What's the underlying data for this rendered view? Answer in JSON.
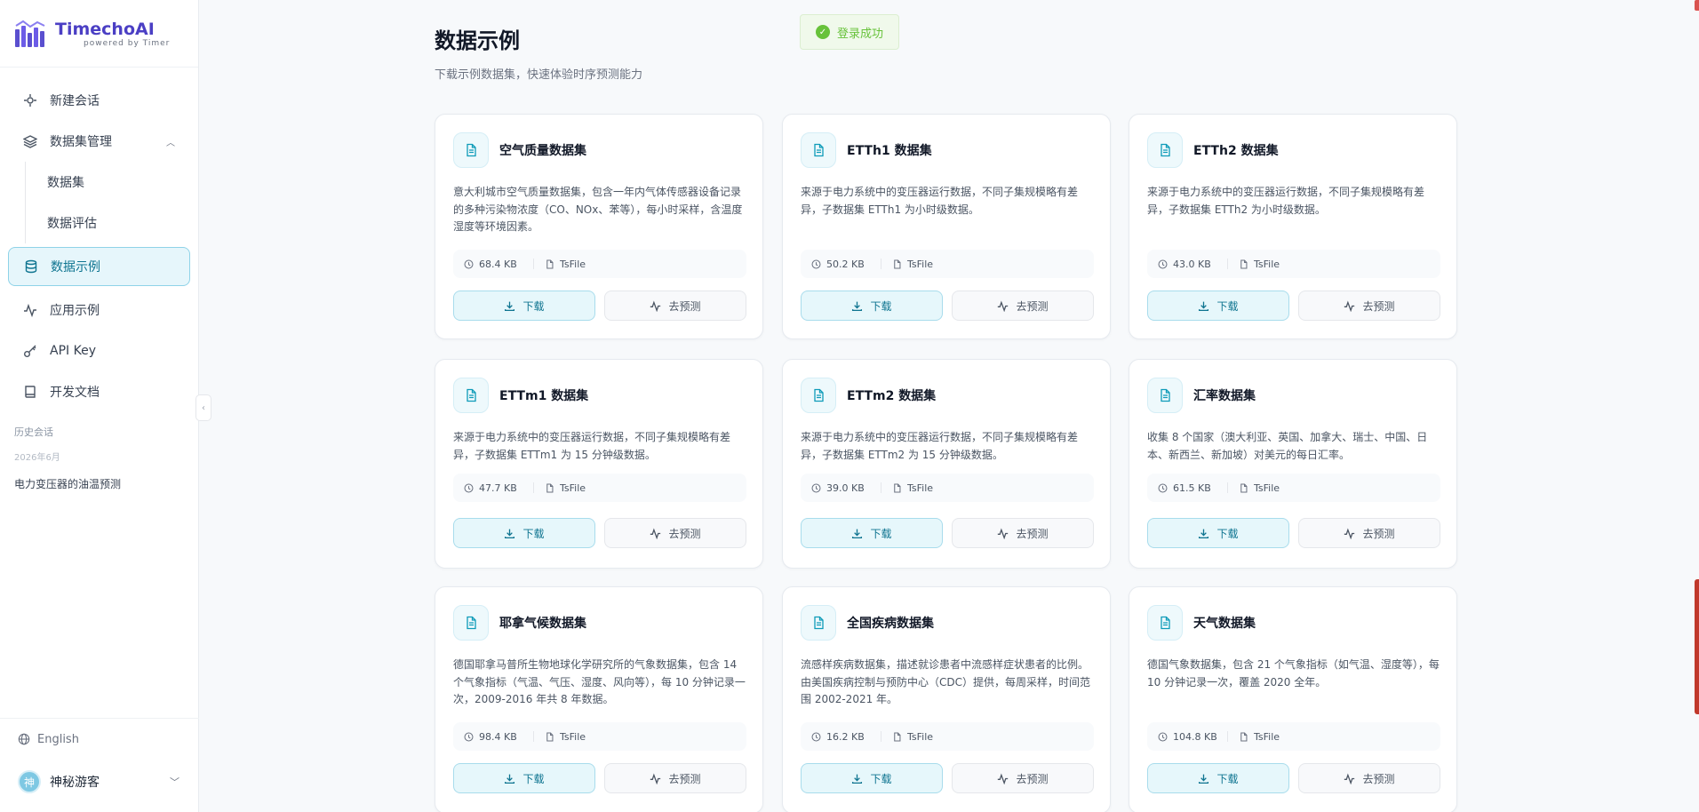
{
  "brand": {
    "name": "TimechoAI",
    "tagline": "powered by Timer",
    "color": "#4b3fc4"
  },
  "sidebar": {
    "items": [
      {
        "label": "新建会话",
        "icon": "sparkle-icon"
      },
      {
        "label": "数据集管理",
        "icon": "layers-icon",
        "expanded": true
      },
      {
        "label": "数据集",
        "sub": true
      },
      {
        "label": "数据评估",
        "sub": true
      },
      {
        "label": "数据示例",
        "icon": "database-icon",
        "active": true
      },
      {
        "label": "应用示例",
        "icon": "activity-icon"
      },
      {
        "label": "API Key",
        "icon": "key-icon"
      },
      {
        "label": "开发文档",
        "icon": "book-icon"
      }
    ],
    "history_label": "历史会话",
    "history_date": "2026年6月",
    "history_items": [
      "电力变压器的油温预测"
    ],
    "language": "English",
    "user_name": "神秘游客",
    "avatar_char": "神"
  },
  "toast": {
    "text": "登录成功",
    "color": "#67c23a"
  },
  "page": {
    "title": "数据示例",
    "subtitle": "下载示例数据集，快速体验时序预测能力"
  },
  "accent": "#0e7490",
  "cards": [
    {
      "title": "空气质量数据集",
      "desc": "意大利城市空气质量数据集，包含一年内气体传感器设备记录的多种污染物浓度（CO、NOx、苯等），每小时采样，含温度湿度等环境因素。",
      "size": "68.4 KB",
      "format": "TsFile",
      "download": "下载",
      "predict": "去预测"
    },
    {
      "title": "ETTh1 数据集",
      "desc": "来源于电力系统中的变压器运行数据，不同子集规模略有差异，子数据集 ETTh1 为小时级数据。",
      "size": "50.2 KB",
      "format": "TsFile",
      "download": "下载",
      "predict": "去预测"
    },
    {
      "title": "ETTh2 数据集",
      "desc": "来源于电力系统中的变压器运行数据，不同子集规模略有差异，子数据集 ETTh2 为小时级数据。",
      "size": "43.0 KB",
      "format": "TsFile",
      "download": "下载",
      "predict": "去预测"
    },
    {
      "title": "ETTm1 数据集",
      "desc": "来源于电力系统中的变压器运行数据，不同子集规模略有差异，子数据集 ETTm1 为 15 分钟级数据。",
      "size": "47.7 KB",
      "format": "TsFile",
      "download": "下载",
      "predict": "去预测"
    },
    {
      "title": "ETTm2 数据集",
      "desc": "来源于电力系统中的变压器运行数据，不同子集规模略有差异，子数据集 ETTm2 为 15 分钟级数据。",
      "size": "39.0 KB",
      "format": "TsFile",
      "download": "下载",
      "predict": "去预测"
    },
    {
      "title": "汇率数据集",
      "desc": "收集 8 个国家（澳大利亚、英国、加拿大、瑞士、中国、日本、新西兰、新加坡）对美元的每日汇率。",
      "size": "61.5 KB",
      "format": "TsFile",
      "download": "下载",
      "predict": "去预测"
    },
    {
      "title": "耶拿气候数据集",
      "desc": "德国耶拿马普所生物地球化学研究所的气象数据集，包含 14 个气象指标（气温、气压、湿度、风向等），每 10 分钟记录一次，2009-2016 年共 8 年数据。",
      "size": "98.4 KB",
      "format": "TsFile",
      "download": "下载",
      "predict": "去预测"
    },
    {
      "title": "全国疾病数据集",
      "desc": "流感样疾病数据集，描述就诊患者中流感样症状患者的比例。由美国疾病控制与预防中心（CDC）提供，每周采样，时间范围 2002-2021 年。",
      "size": "16.2 KB",
      "format": "TsFile",
      "download": "下载",
      "predict": "去预测"
    },
    {
      "title": "天气数据集",
      "desc": "德国气象数据集，包含 21 个气象指标（如气温、湿度等），每 10 分钟记录一次，覆盖 2020 全年。",
      "size": "104.8 KB",
      "format": "TsFile",
      "download": "下载",
      "predict": "去预测"
    }
  ]
}
